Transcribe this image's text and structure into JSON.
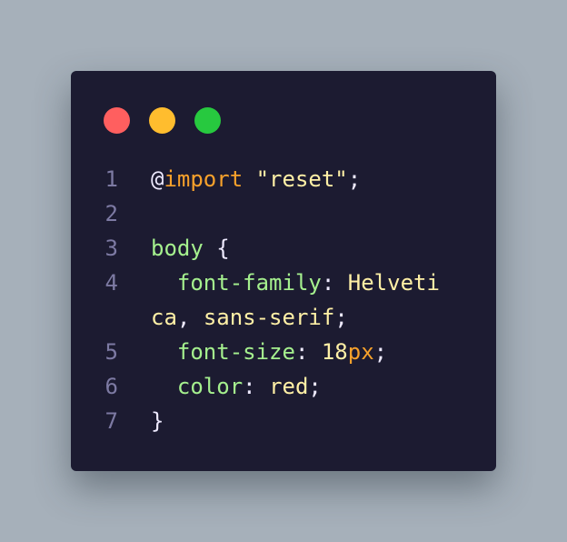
{
  "colors": {
    "background": "#a6b0ba",
    "window": "#1c1b31",
    "close": "#ff5f5f",
    "minimize": "#ffbd2e",
    "maximize": "#27c93f"
  },
  "window_controls": [
    {
      "icon": "close-dot-icon",
      "color": "#ff5f5f"
    },
    {
      "icon": "minimize-dot-icon",
      "color": "#ffbd2e"
    },
    {
      "icon": "maximize-dot-icon",
      "color": "#27c93f"
    }
  ],
  "code": {
    "line_numbers": [
      "1",
      "2",
      "3",
      "4",
      "",
      "5",
      "6",
      "7"
    ],
    "lines": [
      {
        "at": "@",
        "keyword": "import",
        "space": " ",
        "string": "\"reset\"",
        "semi": ";"
      },
      {},
      {
        "selector": "body",
        "space": " ",
        "brace": "{"
      },
      {
        "indent": "  ",
        "property": "font-family",
        "colon": ": ",
        "value": "Helveti"
      },
      {
        "value": "ca",
        "comma": ", ",
        "value2": "sans-serif",
        "semi": ";"
      },
      {
        "indent": "  ",
        "property": "font-size",
        "colon": ": ",
        "number": "18",
        "unit": "px",
        "semi": ";"
      },
      {
        "indent": "  ",
        "property": "color",
        "colon": ": ",
        "value": "red",
        "semi": ";"
      },
      {
        "brace": "}"
      }
    ]
  }
}
